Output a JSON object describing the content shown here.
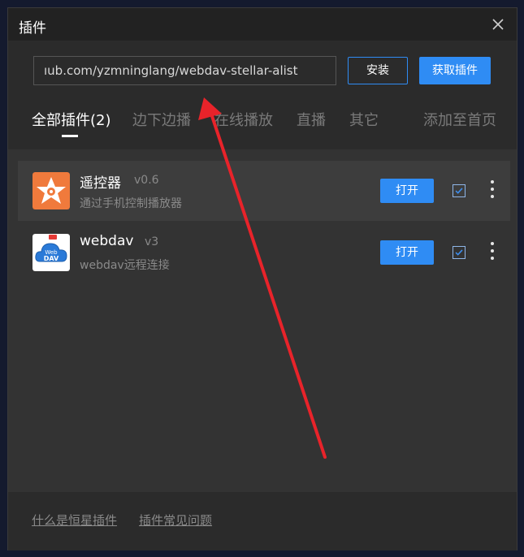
{
  "window": {
    "title": "插件"
  },
  "install": {
    "url_value": "ıub.com/yzmninglang/webdav-stellar-alist",
    "install_label": "安装",
    "get_plugins_label": "获取插件"
  },
  "tabs": [
    {
      "label": "全部插件(2)",
      "active": true
    },
    {
      "label": "边下边播"
    },
    {
      "label": "在线播放"
    },
    {
      "label": "直播"
    },
    {
      "label": "其它"
    }
  ],
  "add_to_home_label": "添加至首页",
  "plugins": [
    {
      "name": "遥控器",
      "version": "v0.6",
      "description": "通过手机控制播放器",
      "open_label": "打开",
      "checked": true,
      "icon": "star-remote-icon"
    },
    {
      "name": "webdav",
      "version": "v3",
      "description": "webdav远程连接",
      "open_label": "打开",
      "checked": true,
      "icon": "webdav-cloud-icon",
      "icon_text": "Web DAV"
    }
  ],
  "footer": {
    "link1": "什么是恒星插件",
    "link2": "插件常见问题"
  },
  "colors": {
    "accent": "#2f8cf4",
    "annotation_arrow": "#e8232a"
  }
}
